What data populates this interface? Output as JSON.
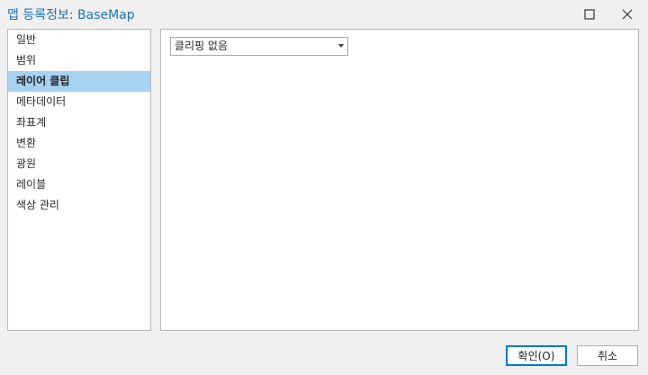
{
  "window": {
    "title": "맵 등록정보: BaseMap"
  },
  "nav": {
    "items": [
      {
        "label": "일반",
        "selected": false
      },
      {
        "label": "범위",
        "selected": false
      },
      {
        "label": "레이어 클립",
        "selected": true
      },
      {
        "label": "메타데이터",
        "selected": false
      },
      {
        "label": "좌표계",
        "selected": false
      },
      {
        "label": "변환",
        "selected": false
      },
      {
        "label": "광원",
        "selected": false
      },
      {
        "label": "레이블",
        "selected": false
      },
      {
        "label": "색상 관리",
        "selected": false
      }
    ]
  },
  "clip": {
    "dropdown_value": "클리핑 없음"
  },
  "footer": {
    "ok_label": "확인(O)",
    "cancel_label": "취소"
  },
  "colors": {
    "title": "#1b75bb",
    "selected_bg": "#a7d2f2",
    "default_button_border": "#0078d7"
  },
  "icons": {
    "maximize": "maximize-icon",
    "close": "close-icon",
    "dropdown": "caret-down-icon"
  }
}
